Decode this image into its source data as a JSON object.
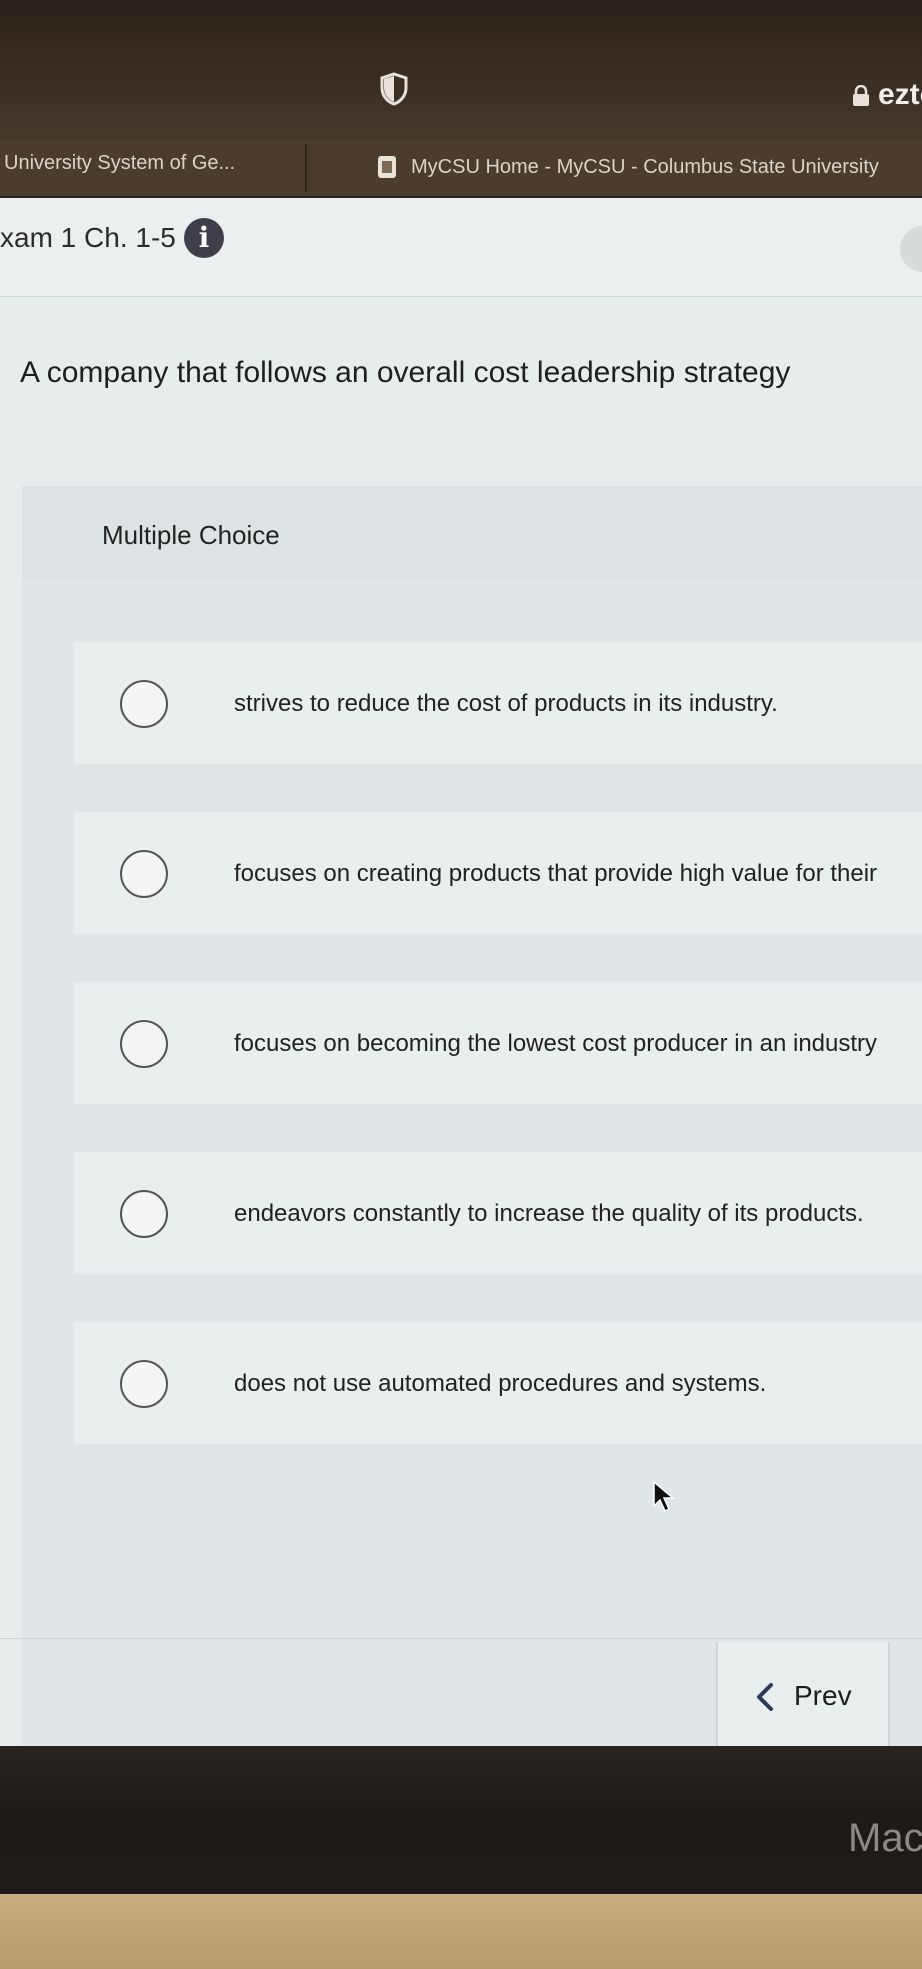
{
  "browser": {
    "url_partial": "ezto",
    "bookmarks": [
      "University System of Ge...",
      "MyCSU Home - MyCSU - Columbus State University"
    ]
  },
  "exam": {
    "title": "xam 1 Ch. 1-5",
    "info_symbol": "i"
  },
  "question": {
    "text": "A company that follows an overall cost leadership strategy",
    "type_label": "Multiple Choice",
    "options": [
      "strives to reduce the cost of products in its industry.",
      "focuses on creating products that provide high value for their",
      "focuses on becoming the lowest cost producer in an industry",
      "endeavors constantly to increase the quality of its products.",
      "does not use automated procedures and systems."
    ]
  },
  "nav": {
    "prev_label": "Prev"
  },
  "monitor": {
    "brand_partial": "Mac"
  }
}
